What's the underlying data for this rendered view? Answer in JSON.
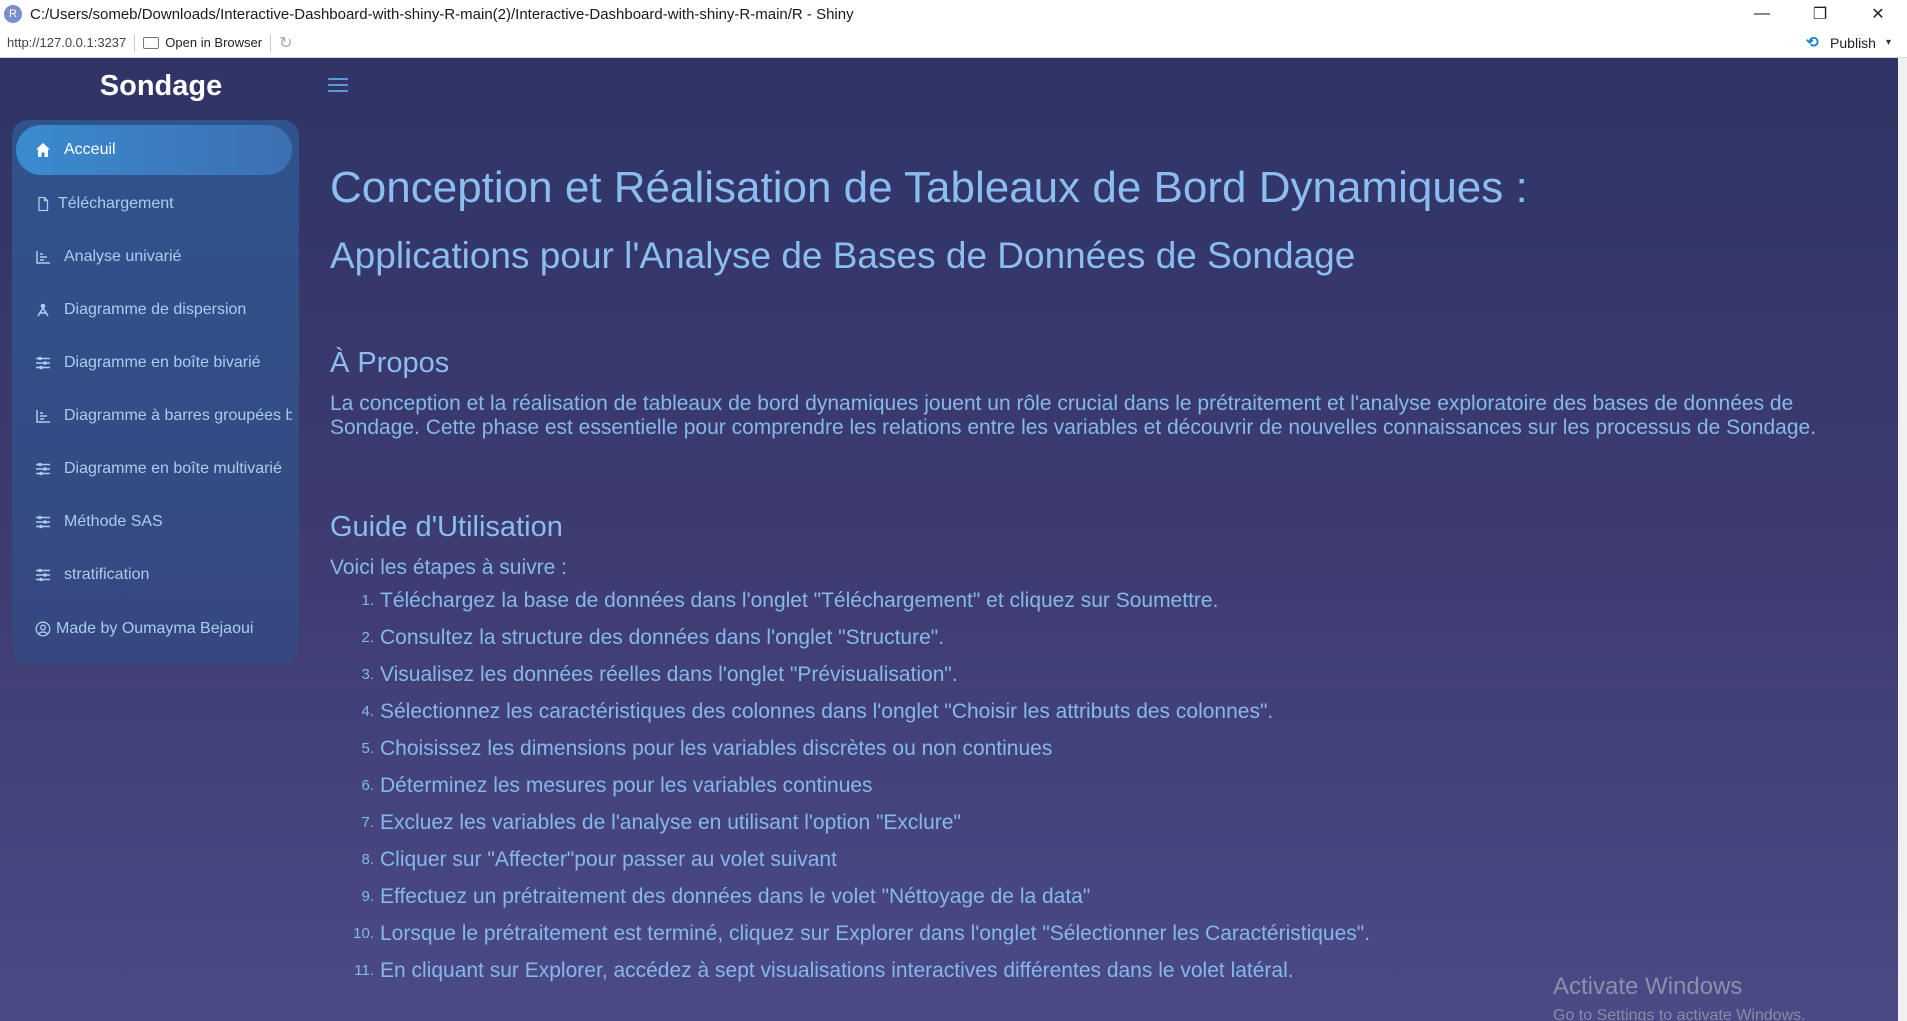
{
  "window": {
    "title": "C:/Users/someb/Downloads/Interactive-Dashboard-with-shiny-R-main(2)/Interactive-Dashboard-with-shiny-R-main/R - Shiny",
    "app_icon": "R",
    "minimize": "—",
    "maximize": "❐",
    "close": "✕"
  },
  "toolbar": {
    "url": "http://127.0.0.1:3237",
    "open_in_browser": "Open in Browser",
    "publish": "Publish"
  },
  "brand": "Sondage",
  "sidebar": {
    "items": [
      {
        "label": "Acceuil",
        "icon": "home-icon",
        "active": true
      },
      {
        "label": "Téléchargement",
        "icon": "file-icon"
      },
      {
        "label": "Analyse univarié",
        "icon": "chart-icon"
      },
      {
        "label": "Diagramme de dispersion",
        "icon": "scatter-icon"
      },
      {
        "label": "Diagramme en boîte bivarié",
        "icon": "sliders-icon"
      },
      {
        "label": "Diagramme à barres groupées bi",
        "icon": "chart-icon"
      },
      {
        "label": "Diagramme en boîte multivarié",
        "icon": "sliders-icon"
      },
      {
        "label": "Méthode SAS",
        "icon": "sliders-icon"
      },
      {
        "label": "stratification",
        "icon": "sliders-icon"
      },
      {
        "label": "Made by Oumayma Bejaoui",
        "icon": "user-circle-icon"
      }
    ]
  },
  "main": {
    "title": "Conception et Réalisation de Tableaux de Bord Dynamiques :",
    "subtitle": "Applications pour l'Analyse de Bases de Données de Sondage",
    "about_heading": "À Propos",
    "about_text": "La conception et la réalisation de tableaux de bord dynamiques jouent un rôle crucial dans le prétraitement et l'analyse exploratoire des bases de données de Sondage. Cette phase est essentielle pour comprendre les relations entre les variables et découvrir de nouvelles connaissances sur les processus de Sondage.",
    "guide_heading": "Guide d'Utilisation",
    "guide_intro": "Voici les étapes à suivre :",
    "steps": [
      "Téléchargez la base de données dans l'onglet \"Téléchargement\" et cliquez sur Soumettre.",
      "Consultez la structure des données dans l'onglet \"Structure\".",
      "Visualisez les données réelles dans l'onglet \"Prévisualisation\".",
      "Sélectionnez les caractéristiques des colonnes dans l'onglet \"Choisir les attributs des colonnes\".",
      "Choisissez les dimensions pour les variables discrètes ou non continues",
      "Déterminez les mesures pour les variables continues",
      "Excluez les variables de l'analyse en utilisant l'option \"Exclure\"",
      "Cliquer sur \"Affecter\"pour passer au volet suivant",
      "Effectuez un prétraitement des données dans le volet \"Néttoyage de la data\"",
      "Lorsque le prétraitement est terminé, cliquez sur Explorer dans l'onglet \"Sélectionner les Caractéristiques\".",
      "En cliquant sur Explorer, accédez à sept visualisations interactives différentes dans le volet latéral."
    ],
    "step_numbers": [
      "1.",
      "2.",
      "3.",
      "4.",
      "5.",
      "6.",
      "7.",
      "8.",
      "9.",
      "10.",
      "11."
    ]
  },
  "watermark": {
    "line1": "Activate Windows",
    "line2": "Go to Settings to activate Windows."
  }
}
